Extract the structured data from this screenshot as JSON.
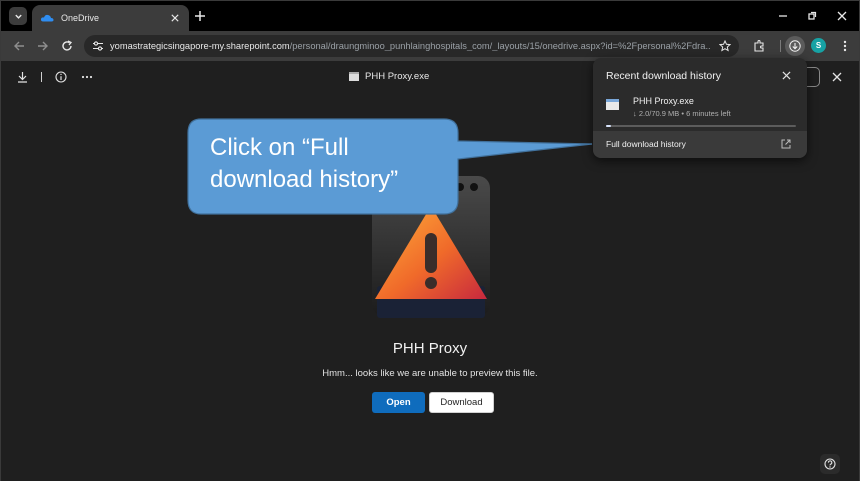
{
  "browser": {
    "tab_title": "OneDrive",
    "url_host": "yomastrategicsingapore-my.sharepoint.com",
    "url_path": "/personal/draungminoo_punhlainghospitals_com/_layouts/15/onedrive.aspx?id=%2Fpersonal%2Fdra...",
    "avatar_letter": "S",
    "accent_color": "#17a2a4"
  },
  "viewer": {
    "file_title": "PHH Proxy.exe",
    "preview_name": "PHH Proxy",
    "preview_message": "Hmm... looks like we are unable to preview this file.",
    "open_label": "Open",
    "download_label": "Download",
    "open_color": "#0f6cbd"
  },
  "download_popup": {
    "header": "Recent download history",
    "item_name": "PHH Proxy.exe",
    "item_meta": "↓ 2.0/70.9 MB • 6 minutes left",
    "progress": 0.028,
    "full_history_label": "Full download history"
  },
  "callout": {
    "text": "Click on “Full download history”",
    "color": "#5b9bd5"
  },
  "icons": [
    "tab-search-icon",
    "onedrive-icon",
    "close-icon",
    "plus-icon",
    "minimize-icon",
    "restore-icon",
    "back-icon",
    "forward-icon",
    "reload-icon",
    "tune-icon",
    "star-icon",
    "extensions-icon",
    "download-icon",
    "info-icon",
    "more-icon",
    "help-icon",
    "external-link-icon",
    "warning-icon"
  ]
}
